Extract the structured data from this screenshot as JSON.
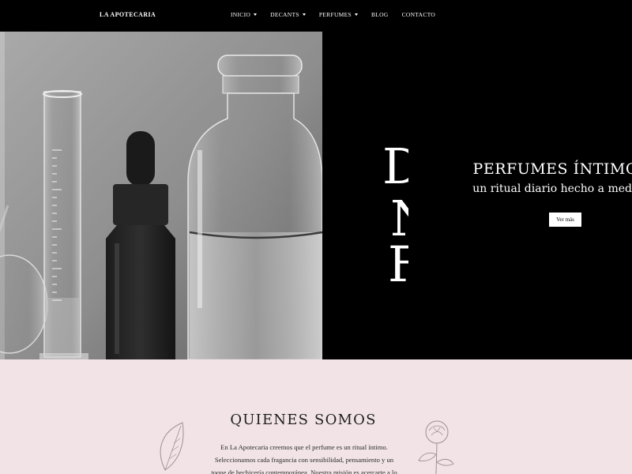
{
  "header": {
    "brand": "LA APOTECARIA",
    "nav": [
      {
        "label": "INICIO",
        "dropdown": true
      },
      {
        "label": "DECANTS",
        "dropdown": true
      },
      {
        "label": "PERFUMES",
        "dropdown": true
      },
      {
        "label": "BLOG",
        "dropdown": false
      },
      {
        "label": "CONTACTO",
        "dropdown": false
      }
    ]
  },
  "hero": {
    "title": "PERFUMES ÍNTIMOS",
    "subtitle": "un ritual diario hecho a medida",
    "button": "Ver más",
    "background_letters": [
      "D",
      "N",
      "F"
    ]
  },
  "about": {
    "title": "QUIENES SOMOS",
    "lines": [
      "En La Apotecaria creemos que el perfume es un ritual íntimo.",
      "Seleccionamos cada fragancia con sensibilidad, pensamiento y un",
      "toque de hechicería contemporánea. Nuestra misión es acercarte a lo"
    ]
  },
  "icons": {
    "leaf": "leaf-icon",
    "rose": "rose-icon"
  }
}
